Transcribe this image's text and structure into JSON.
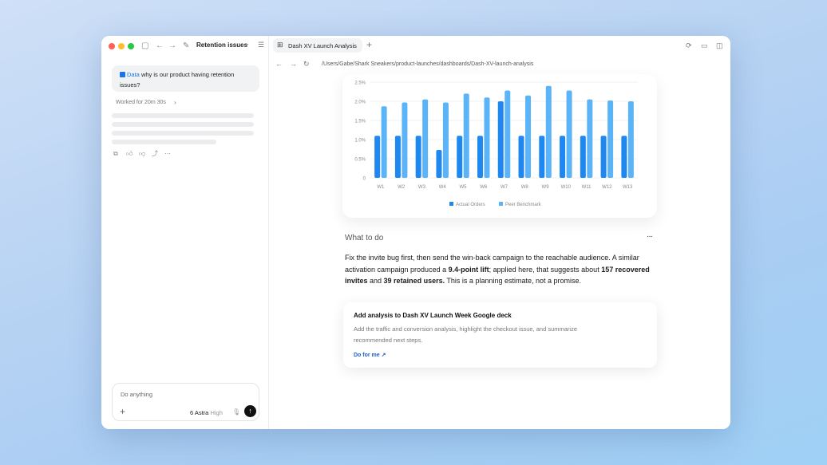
{
  "left_panel": {
    "title": "Retention issues",
    "message": {
      "tag": "Data",
      "text": "why is our product having retention issues?"
    },
    "worked_label": "Worked for 20m 30s",
    "composer": {
      "placeholder": "Do anything",
      "model": "6 Astra",
      "level": "High"
    }
  },
  "right_panel": {
    "tab_label": "Dash XV Launch Analysis",
    "path": "/Users/Gabe/Shark Sneakers/product-launches/dashboards/Dash-XV-launch-analysis",
    "section_title": "What to do",
    "paragraph": {
      "p1": "Fix the invite bug first, then send the win-back campaign to the reachable audience. A similar activation campaign produced a ",
      "b1": "9.4-point lift",
      "p2": "; applied here, that suggests about ",
      "b2": "157 recovered invites",
      "p3": " and ",
      "b3": "39 retained users.",
      "p4": " This is a planning estimate, not a promise."
    },
    "task_card": {
      "title": "Add analysis to Dash XV Launch Week Google deck",
      "description": "Add the traffic and conversion analysis, highlight the checkout issue, and summarize recommended next steps.",
      "link": "Do for me"
    }
  },
  "chart_data": {
    "type": "bar",
    "categories": [
      "W1",
      "W2",
      "W3",
      "W4",
      "W5",
      "W6",
      "W7",
      "W8",
      "W9",
      "W10",
      "W11",
      "W12",
      "W13"
    ],
    "series": [
      {
        "name": "Actual Orders",
        "color": "#1e88f0",
        "values": [
          1.1,
          1.1,
          1.1,
          0.73,
          1.1,
          1.1,
          2.0,
          1.1,
          1.1,
          1.1,
          1.1,
          1.1,
          1.1
        ]
      },
      {
        "name": "Peer Benchmark",
        "color": "#5bb4f8",
        "values": [
          1.87,
          1.97,
          2.05,
          1.97,
          2.2,
          2.1,
          2.28,
          2.15,
          2.4,
          2.28,
          2.05,
          2.02,
          2.0
        ]
      }
    ],
    "yticks": [
      "2.5%",
      "2.0%",
      "1.5%",
      "1.0%",
      "0.5%",
      "0"
    ],
    "ylim": [
      0,
      2.5
    ],
    "legend_position": "bottom"
  }
}
